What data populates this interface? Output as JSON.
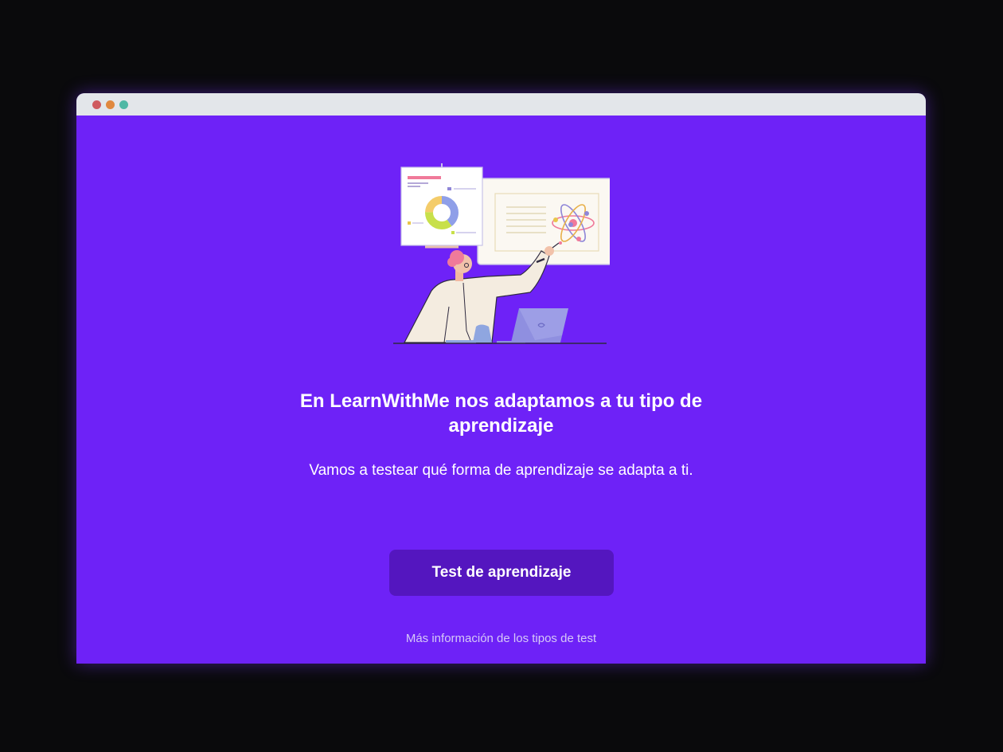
{
  "window": {
    "controls": [
      {
        "name": "close",
        "color": "#cf5a5f"
      },
      {
        "name": "minimize",
        "color": "#e0883f"
      },
      {
        "name": "maximize",
        "color": "#4fb8a5"
      }
    ]
  },
  "colors": {
    "background": "#6e22f7",
    "button": "#5416bf",
    "text": "#ffffff",
    "link": "#d6c9f7"
  },
  "main": {
    "illustration_icon": "teacher-presenting-science-board-illustration",
    "headline": "En LearnWithMe nos adaptamos a tu tipo de aprendizaje",
    "subtitle": "Vamos a testear qué forma de aprendizaje se adapta a ti.",
    "cta_label": "Test de aprendizaje",
    "more_info_link": "Más información de los tipos de test"
  }
}
